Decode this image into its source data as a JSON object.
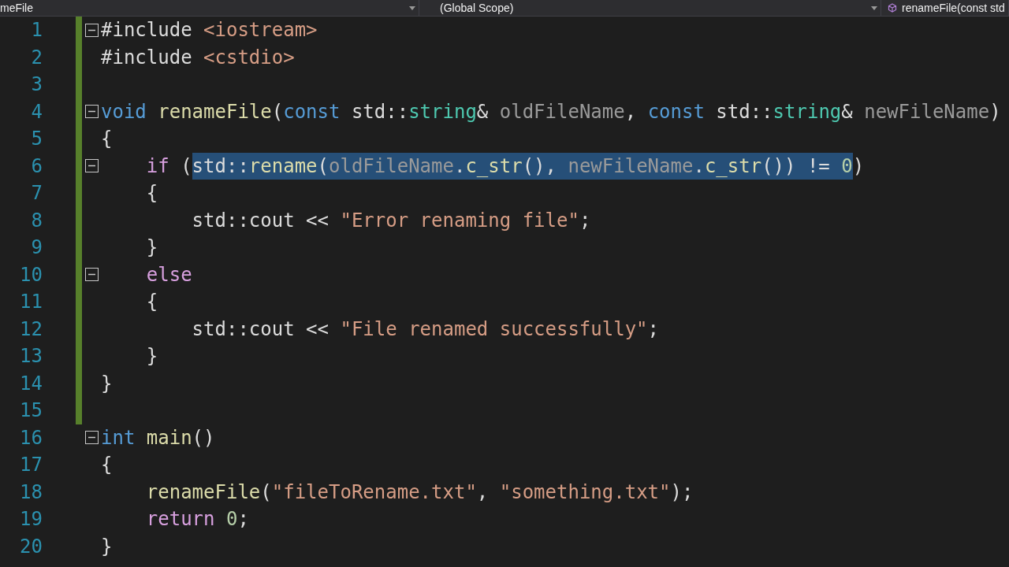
{
  "navigation_bar": [
    {
      "label": "meFile",
      "has_icon": false
    },
    {
      "label": "(Global Scope)",
      "has_icon": false
    },
    {
      "label": "renameFile(const std",
      "has_icon": true
    }
  ],
  "lines": [
    {
      "number": "1",
      "changed": true,
      "fold_marker": true,
      "tokens": [
        {
          "t": "#include",
          "kind": "plain"
        },
        {
          "t": " <iostream>",
          "kind": "string"
        }
      ]
    },
    {
      "number": "2",
      "changed": true,
      "fold_marker": false,
      "tokens": [
        {
          "t": "#include",
          "kind": "plain"
        },
        {
          "t": " <cstdio>",
          "kind": "string"
        }
      ]
    },
    {
      "number": "3",
      "changed": true,
      "fold_marker": false
    },
    {
      "number": "4",
      "changed": true,
      "fold_marker": true,
      "tokens": [
        {
          "t": "void ",
          "kind": "keyword"
        },
        {
          "t": "renameFile",
          "kind": "func"
        },
        {
          "t": "(",
          "kind": "plain"
        },
        {
          "t": "const",
          "kind": "keyword"
        },
        {
          "t": " std::",
          "kind": "plain"
        },
        {
          "t": "string",
          "kind": "type"
        },
        {
          "t": "& ",
          "kind": "plain"
        },
        {
          "t": "oldFileName",
          "kind": "param"
        },
        {
          "t": ", ",
          "kind": "plain"
        },
        {
          "t": "const",
          "kind": "keyword"
        },
        {
          "t": " std::",
          "kind": "plain"
        },
        {
          "t": "string",
          "kind": "type"
        },
        {
          "t": "& ",
          "kind": "plain"
        },
        {
          "t": "newFileName",
          "kind": "param"
        },
        {
          "t": ")",
          "kind": "plain"
        }
      ]
    },
    {
      "number": "5",
      "changed": true,
      "fold_marker": false,
      "tokens": [
        {
          "t": "{",
          "kind": "plain"
        }
      ]
    },
    {
      "number": "6",
      "changed": true,
      "fold_marker": true,
      "tokens": [
        {
          "t": "    if",
          "kind": "control",
          "selected": false
        },
        {
          "t": " (",
          "kind": "plain",
          "selected": false
        },
        {
          "t": "std::",
          "kind": "plain",
          "selected": true
        },
        {
          "t": "rename",
          "kind": "func",
          "selected": true
        },
        {
          "t": "(",
          "kind": "plain",
          "selected": true
        },
        {
          "t": "oldFileName",
          "kind": "param",
          "selected": true
        },
        {
          "t": ".",
          "kind": "plain",
          "selected": true
        },
        {
          "t": "c_str",
          "kind": "func",
          "selected": true
        },
        {
          "t": "(), ",
          "kind": "plain",
          "selected": true
        },
        {
          "t": "newFileName",
          "kind": "param",
          "selected": true
        },
        {
          "t": ".",
          "kind": "plain",
          "selected": true
        },
        {
          "t": "c_str",
          "kind": "func",
          "selected": true
        },
        {
          "t": "()) != ",
          "kind": "plain",
          "selected": true
        },
        {
          "t": "0",
          "kind": "number",
          "selected": true
        },
        {
          "t": ")",
          "kind": "plain",
          "selected": false
        }
      ]
    },
    {
      "number": "7",
      "changed": true,
      "fold_marker": false,
      "tokens": [
        {
          "t": "    {",
          "kind": "plain"
        }
      ]
    },
    {
      "number": "8",
      "changed": true,
      "fold_marker": false,
      "tokens": [
        {
          "t": "        std::cout << ",
          "kind": "plain"
        },
        {
          "t": "\"Error renaming file\"",
          "kind": "string"
        },
        {
          "t": ";",
          "kind": "plain"
        }
      ]
    },
    {
      "number": "9",
      "changed": true,
      "fold_marker": false,
      "tokens": [
        {
          "t": "    }",
          "kind": "plain"
        }
      ]
    },
    {
      "number": "10",
      "changed": true,
      "fold_marker": true,
      "tokens": [
        {
          "t": "    else",
          "kind": "control"
        }
      ]
    },
    {
      "number": "11",
      "changed": true,
      "fold_marker": false,
      "tokens": [
        {
          "t": "    {",
          "kind": "plain"
        }
      ]
    },
    {
      "number": "12",
      "changed": true,
      "fold_marker": false,
      "tokens": [
        {
          "t": "        std::cout << ",
          "kind": "plain"
        },
        {
          "t": "\"File renamed successfully\"",
          "kind": "string"
        },
        {
          "t": ";",
          "kind": "plain"
        }
      ]
    },
    {
      "number": "13",
      "changed": true,
      "fold_marker": false,
      "tokens": [
        {
          "t": "    }",
          "kind": "plain"
        }
      ]
    },
    {
      "number": "14",
      "changed": true,
      "fold_marker": false,
      "tokens": [
        {
          "t": "}",
          "kind": "plain"
        }
      ]
    },
    {
      "number": "15",
      "changed": true,
      "fold_marker": false
    },
    {
      "number": "16",
      "changed": false,
      "fold_marker": true,
      "tokens": [
        {
          "t": "int ",
          "kind": "keyword"
        },
        {
          "t": "main",
          "kind": "func"
        },
        {
          "t": "()",
          "kind": "plain"
        }
      ]
    },
    {
      "number": "17",
      "changed": false,
      "fold_marker": false,
      "tokens": [
        {
          "t": "{",
          "kind": "plain"
        }
      ]
    },
    {
      "number": "18",
      "changed": false,
      "fold_marker": false,
      "tokens": [
        {
          "t": "    renameFile",
          "kind": "func"
        },
        {
          "t": "(",
          "kind": "plain"
        },
        {
          "t": "\"fileToRename.txt\"",
          "kind": "string"
        },
        {
          "t": ", ",
          "kind": "plain"
        },
        {
          "t": "\"something.txt\"",
          "kind": "string"
        },
        {
          "t": ");",
          "kind": "plain"
        }
      ]
    },
    {
      "number": "19",
      "changed": false,
      "fold_marker": false,
      "tokens": [
        {
          "t": "    return ",
          "kind": "control"
        },
        {
          "t": "0",
          "kind": "number"
        },
        {
          "t": ";",
          "kind": "plain"
        }
      ]
    },
    {
      "number": "20",
      "changed": false,
      "fold_marker": false,
      "tokens": [
        {
          "t": "}",
          "kind": "plain"
        }
      ]
    }
  ]
}
